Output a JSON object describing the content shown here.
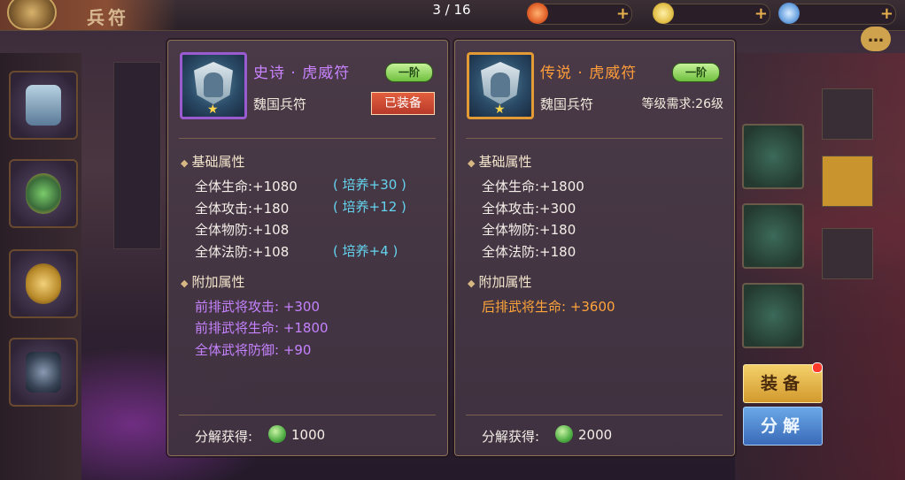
{
  "header": {
    "screen_title": "兵符",
    "pager": "3 / 16",
    "resources": [
      {
        "icon": "fire-gem-icon",
        "value": "",
        "color": "#e2622a"
      },
      {
        "icon": "gold-ingot-icon",
        "value": "",
        "color": "#e3c04a"
      },
      {
        "icon": "crystal-icon",
        "value": "",
        "color": "#6aa2e0"
      }
    ],
    "chat_glyph": "…"
  },
  "right_tabs": [
    {
      "label": "",
      "active": false
    },
    {
      "label": "",
      "active": true
    },
    {
      "label": "",
      "active": false
    }
  ],
  "left_item": {
    "name": "史诗 · 虎威符",
    "rarity_color": "#c983ff",
    "tier": "一阶",
    "subtype": "魏国兵符",
    "equipped_tag": "已装备",
    "base_section": "基础属性",
    "base_stats": [
      {
        "text": "全体生命:+1080",
        "training": "( 培养+30 )"
      },
      {
        "text": "全体攻击:+180",
        "training": "( 培养+12 )"
      },
      {
        "text": "全体物防:+108",
        "training": ""
      },
      {
        "text": "全体法防:+108",
        "training": "( 培养+4 )"
      }
    ],
    "extra_section": "附加属性",
    "extra_stats": [
      "前排武将攻击: +300",
      "前排武将生命: +1800",
      "全体武将防御: +90"
    ],
    "salvage_label": "分解获得:",
    "salvage_value": "1000"
  },
  "right_item": {
    "name": "传说 · 虎威符",
    "rarity_color": "#ff9c3a",
    "tier": "一阶",
    "subtype": "魏国兵符",
    "level_req": "等级需求:26级",
    "base_section": "基础属性",
    "base_stats": [
      "全体生命:+1800",
      "全体攻击:+300",
      "全体物防:+180",
      "全体法防:+180"
    ],
    "extra_section": "附加属性",
    "extra_stats": [
      "后排武将生命: +3600"
    ],
    "salvage_label": "分解获得:",
    "salvage_value": "2000"
  },
  "actions": {
    "equip_label": "装备",
    "salvage_label": "分解"
  }
}
